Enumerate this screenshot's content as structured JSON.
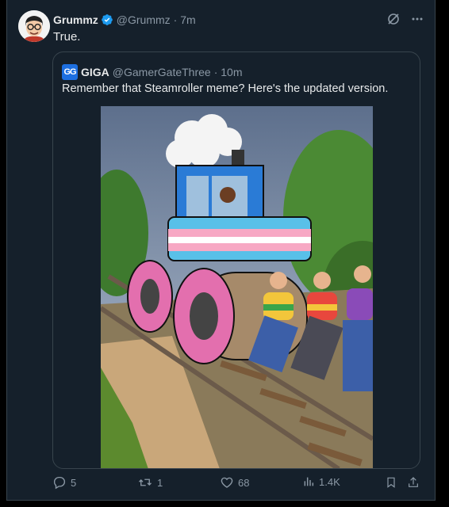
{
  "post": {
    "author_name": "Grummz",
    "author_handle": "@Grummz",
    "time": "· 7m",
    "text": "True."
  },
  "quote": {
    "logo_text": "GG",
    "author_name": "GIGA",
    "author_handle": "@GamerGateThree",
    "time": "· 10m",
    "text": "Remember that Steamroller meme? Here's the updated version.",
    "image_icon": "steamroller-meme-image"
  },
  "actions": {
    "replies": "5",
    "reposts": "1",
    "likes": "68",
    "views": "1.4K"
  },
  "colors": {
    "background": "#15202b",
    "border": "#38444d",
    "muted": "#8b98a5",
    "verified": "#1d9bf0"
  }
}
